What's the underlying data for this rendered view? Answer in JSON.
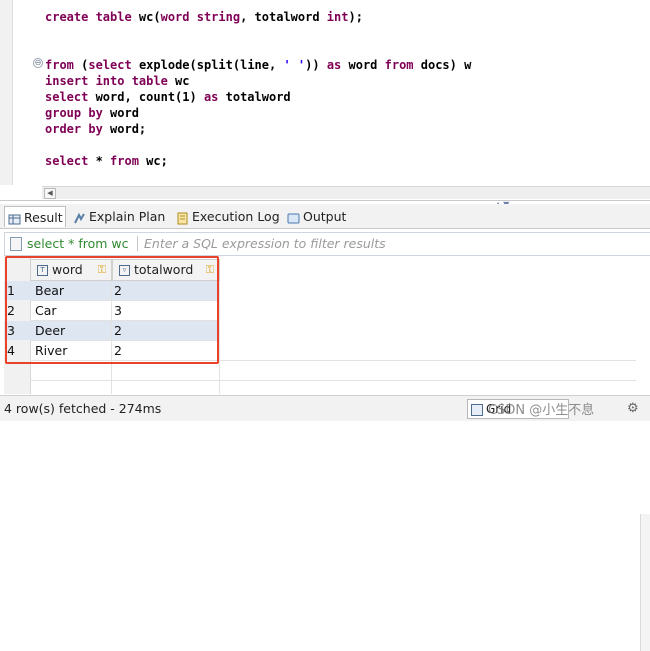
{
  "editor": {
    "lines": [
      {
        "segments": [
          {
            "t": "create table ",
            "c": "kw"
          },
          {
            "t": "wc(",
            "c": "plain"
          },
          {
            "t": "word string",
            "c": "kw"
          },
          {
            "t": ", totalword ",
            "c": "plain"
          },
          {
            "t": "int",
            "c": "kw"
          },
          {
            "t": ");",
            "c": "plain"
          }
        ]
      },
      {
        "segments": [
          {
            "t": "from",
            "c": "kw"
          },
          {
            "t": " (",
            "c": "plain"
          },
          {
            "t": "select",
            "c": "kw"
          },
          {
            "t": " explode(split(line, ",
            "c": "plain"
          },
          {
            "t": "' '",
            "c": "str"
          },
          {
            "t": ")) ",
            "c": "plain"
          },
          {
            "t": "as",
            "c": "kw"
          },
          {
            "t": " word ",
            "c": "plain"
          },
          {
            "t": "from",
            "c": "kw"
          },
          {
            "t": " docs) w",
            "c": "plain"
          }
        ]
      },
      {
        "segments": [
          {
            "t": "insert into table ",
            "c": "kw"
          },
          {
            "t": "wc",
            "c": "plain"
          }
        ]
      },
      {
        "segments": [
          {
            "t": "select",
            "c": "kw"
          },
          {
            "t": " word, count(1) ",
            "c": "plain"
          },
          {
            "t": "as",
            "c": "kw"
          },
          {
            "t": " totalword",
            "c": "plain"
          }
        ]
      },
      {
        "segments": [
          {
            "t": "group by",
            "c": "kw"
          },
          {
            "t": " word",
            "c": "plain"
          }
        ]
      },
      {
        "segments": [
          {
            "t": "order by",
            "c": "kw"
          },
          {
            "t": " word;",
            "c": "plain"
          }
        ]
      },
      {
        "segments": [
          {
            "t": "select",
            "c": "kw"
          },
          {
            "t": " * ",
            "c": "plain"
          },
          {
            "t": "from",
            "c": "kw"
          },
          {
            "t": " wc;",
            "c": "plain"
          }
        ]
      }
    ],
    "fold_marker": "⊖",
    "scroll_left_arrow": "◀"
  },
  "tabs": [
    {
      "label": "Result",
      "icon": "result-grid-icon",
      "active": true
    },
    {
      "label": "Explain Plan",
      "icon": "explain-plan-icon",
      "active": false
    },
    {
      "label": "Execution Log",
      "icon": "execution-log-icon",
      "active": false
    },
    {
      "label": "Output",
      "icon": "output-icon",
      "active": false
    }
  ],
  "filter": {
    "query": "select * from wc",
    "placeholder": "Enter a SQL expression to filter results"
  },
  "grid": {
    "columns": [
      {
        "name": "word",
        "type_icon": "text-type-icon"
      },
      {
        "name": "totalword",
        "type_icon": "numeric-type-icon"
      }
    ],
    "rows": [
      {
        "num": "1",
        "word": "Bear",
        "totalword": "2"
      },
      {
        "num": "2",
        "word": "Car",
        "totalword": "3"
      },
      {
        "num": "3",
        "word": "Deer",
        "totalword": "2"
      },
      {
        "num": "4",
        "word": "River",
        "totalword": "2"
      }
    ]
  },
  "status": {
    "fetched": "4 row(s) fetched - 274ms",
    "view_mode": "Grid",
    "watermark": "CSDN @小生不息"
  },
  "colors": {
    "keyword": "#7f0055",
    "string": "#2a00ff",
    "filter_query": "#2f8a2f",
    "row_alt": "#dde6f1",
    "highlight": "#e8412c"
  }
}
